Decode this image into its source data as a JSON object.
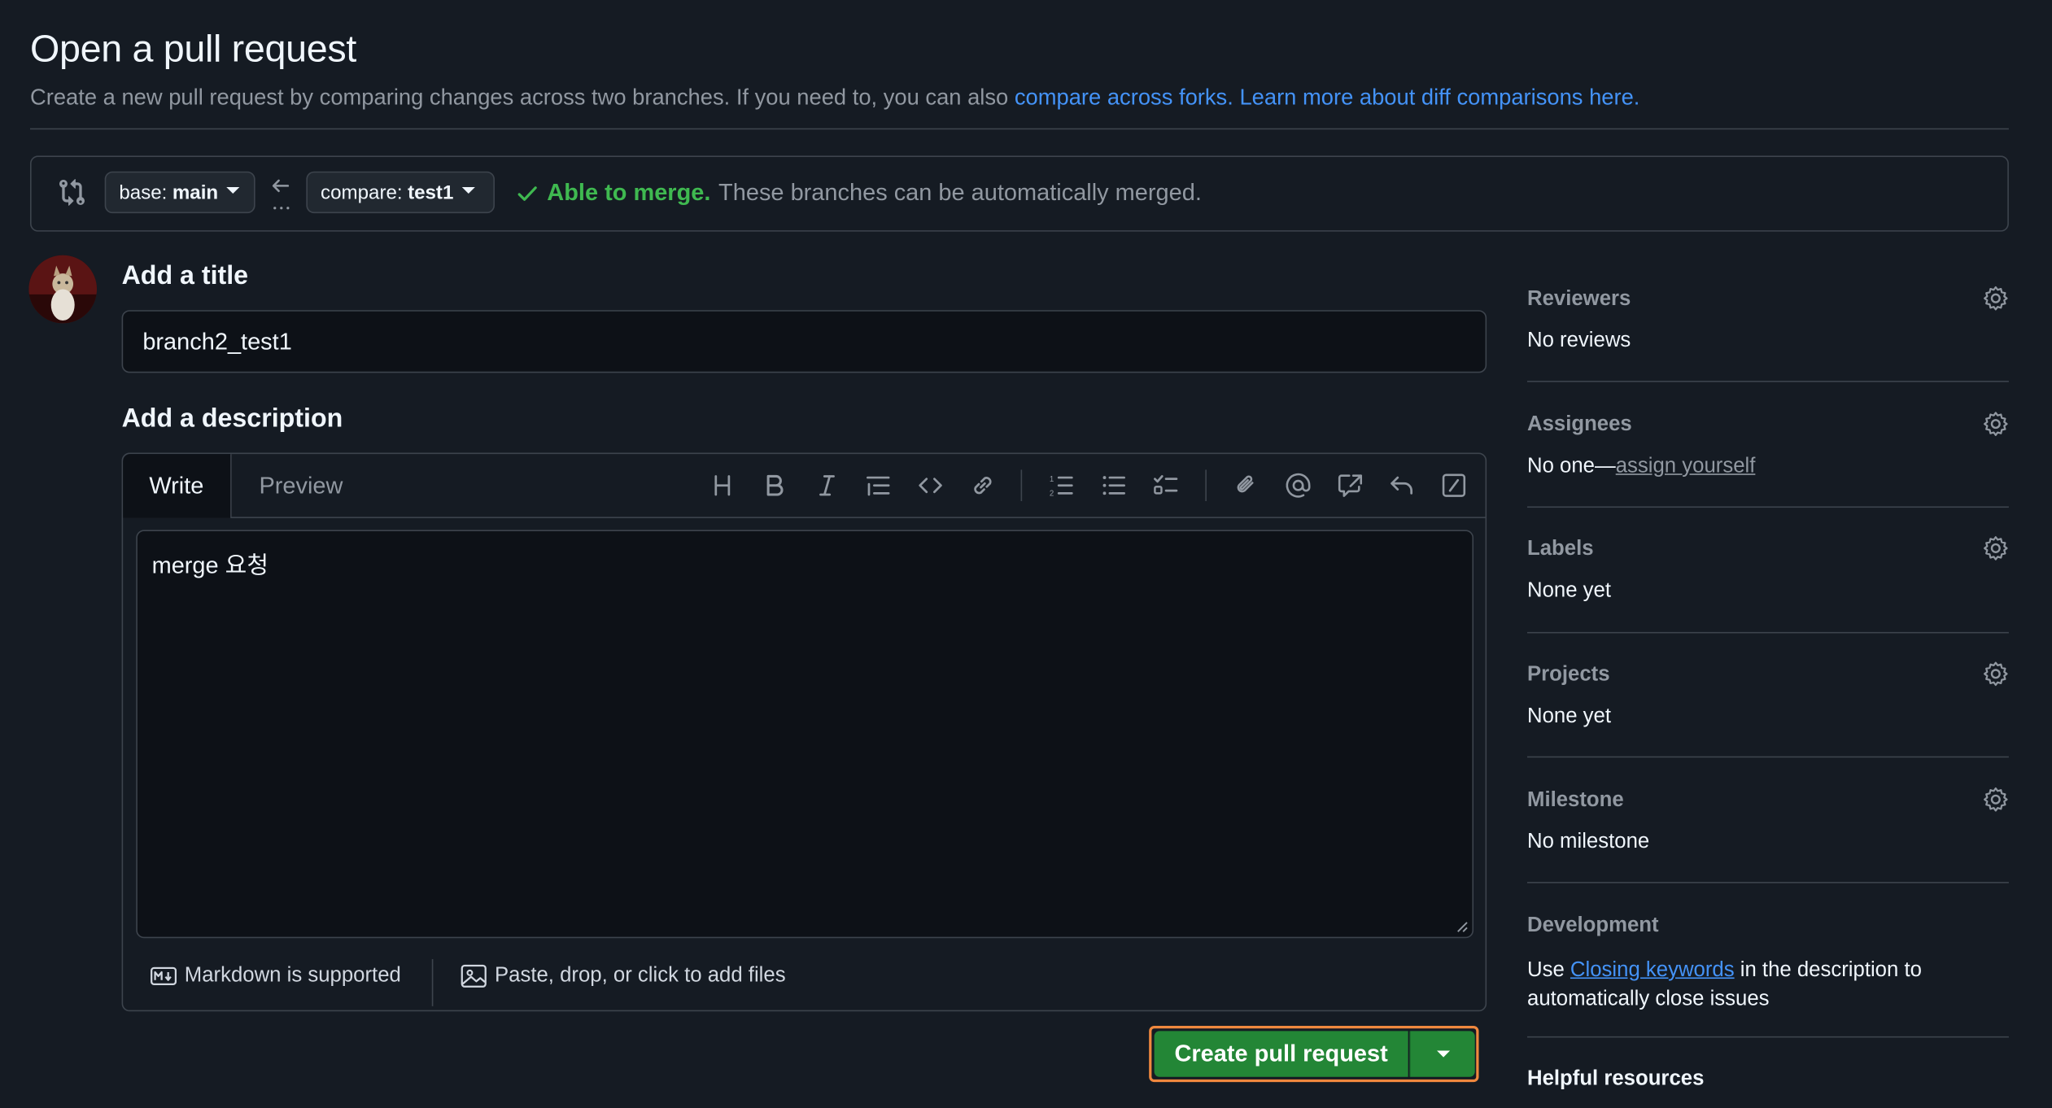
{
  "header": {
    "title": "Open a pull request",
    "subtitle_text": "Create a new pull request by comparing changes across two branches. If you need to, you can also ",
    "compare_forks_link": "compare across forks.",
    "learn_more_link": "Learn more about diff comparisons here."
  },
  "compare": {
    "base_prefix": "base:",
    "base_branch": "main",
    "compare_prefix": "compare:",
    "compare_branch": "test1",
    "merge_status": "Able to merge.",
    "merge_message": "These branches can be automatically merged."
  },
  "form": {
    "title_label": "Add a title",
    "title_value": "branch2_test1",
    "description_label": "Add a description",
    "tab_write": "Write",
    "tab_preview": "Preview",
    "description_value": "merge 요청",
    "markdown_note": "Markdown is supported",
    "attach_note": "Paste, drop, or click to add files",
    "submit_label": "Create pull request"
  },
  "toolbar_icons": [
    "heading-icon",
    "bold-icon",
    "italic-icon",
    "quote-icon",
    "code-icon",
    "link-icon",
    "ordered-list-icon",
    "unordered-list-icon",
    "task-list-icon",
    "attach-icon",
    "mention-icon",
    "reference-icon",
    "undo-icon",
    "slash-command-icon"
  ],
  "sidebar": {
    "reviewers": {
      "title": "Reviewers",
      "value": "No reviews"
    },
    "assignees": {
      "title": "Assignees",
      "value": "No one—",
      "assign_link": "assign yourself"
    },
    "labels": {
      "title": "Labels",
      "value": "None yet"
    },
    "projects": {
      "title": "Projects",
      "value": "None yet"
    },
    "milestone": {
      "title": "Milestone",
      "value": "No milestone"
    },
    "development": {
      "title": "Development",
      "text_before": "Use ",
      "link": "Closing keywords",
      "text_after": " in the description to automatically close issues"
    },
    "helpful": "Helpful resources"
  },
  "colors": {
    "background": "#151b23",
    "accent_link": "#4493f8",
    "success": "#3fb950",
    "button_green": "#238636",
    "highlight_outline": "#f0883e"
  }
}
